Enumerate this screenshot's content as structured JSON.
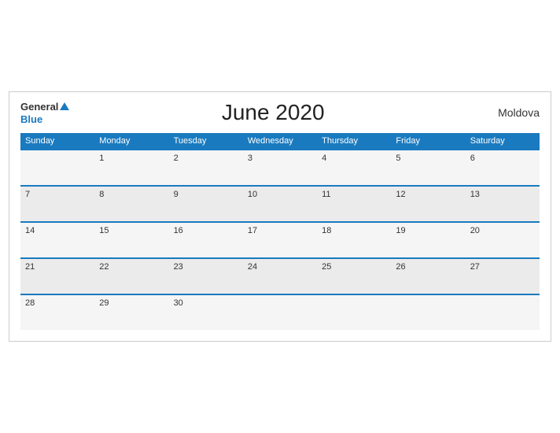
{
  "header": {
    "logo_general": "General",
    "logo_blue": "Blue",
    "title": "June 2020",
    "country": "Moldova"
  },
  "weekdays": [
    "Sunday",
    "Monday",
    "Tuesday",
    "Wednesday",
    "Thursday",
    "Friday",
    "Saturday"
  ],
  "weeks": [
    [
      "",
      "1",
      "2",
      "3",
      "4",
      "5",
      "6"
    ],
    [
      "7",
      "8",
      "9",
      "10",
      "11",
      "12",
      "13"
    ],
    [
      "14",
      "15",
      "16",
      "17",
      "18",
      "19",
      "20"
    ],
    [
      "21",
      "22",
      "23",
      "24",
      "25",
      "26",
      "27"
    ],
    [
      "28",
      "29",
      "30",
      "",
      "",
      "",
      ""
    ]
  ]
}
